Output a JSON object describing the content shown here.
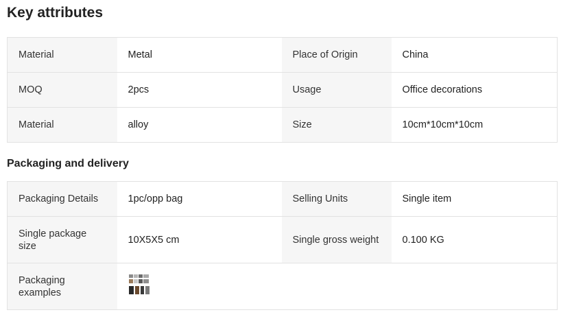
{
  "key_attributes": {
    "title": "Key attributes",
    "rows": [
      [
        {
          "label": "Material",
          "value": "Metal"
        },
        {
          "label": "Place of Origin",
          "value": "China"
        }
      ],
      [
        {
          "label": "MOQ",
          "value": "2pcs"
        },
        {
          "label": "Usage",
          "value": "Office decorations"
        }
      ],
      [
        {
          "label": "Material",
          "value": "alloy"
        },
        {
          "label": "Size",
          "value": "10cm*10cm*10cm"
        }
      ]
    ]
  },
  "packaging": {
    "title": "Packaging and delivery",
    "rows": [
      [
        {
          "label": "Packaging Details",
          "value": "1pc/opp bag"
        },
        {
          "label": "Selling Units",
          "value": "Single item"
        }
      ],
      [
        {
          "label": "Single package size",
          "value": "10X5X5 cm"
        },
        {
          "label": "Single gross weight",
          "value": "0.100 KG"
        }
      ]
    ],
    "examples_label": "Packaging examples"
  },
  "colors": {
    "label_bg": "#f6f6f6",
    "border": "#e2e2e2"
  }
}
